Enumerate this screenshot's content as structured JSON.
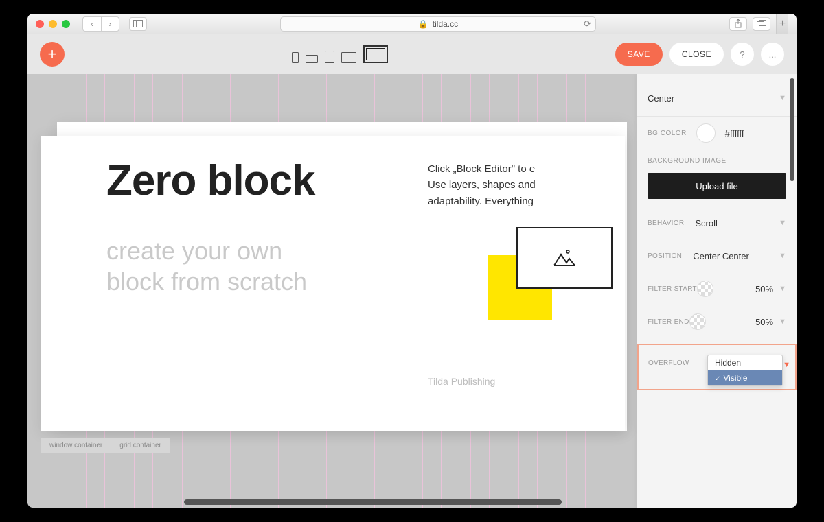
{
  "browser": {
    "url": "tilda.cc",
    "lock_icon": "🔒"
  },
  "toolbar": {
    "save_label": "SAVE",
    "close_label": "CLOSE",
    "more_label": "..."
  },
  "canvas": {
    "heading": "Zero block",
    "subtitle_line1": "create your own",
    "subtitle_line2": "block from scratch",
    "paragraph_line1": "Click „Block Editor\" to e",
    "paragraph_line2": "Use layers, shapes and",
    "paragraph_line3": "adaptability. Everything",
    "caption": "Tilda Publishing",
    "footer1": "window container",
    "footer2": "grid container"
  },
  "panel": {
    "align_value": "Center",
    "bg_color_label": "BG COLOR",
    "bg_color_value": "#ffffff",
    "bg_image_label": "BACKGROUND IMAGE",
    "upload_label": "Upload file",
    "behavior_label": "BEHAVIOR",
    "behavior_value": "Scroll",
    "position_label": "POSITION",
    "position_value": "Center Center",
    "filter_start_label": "FILTER START",
    "filter_start_value": "50%",
    "filter_end_label": "FILTER END",
    "filter_end_value": "50%",
    "overflow_label": "OVERFLOW",
    "overflow_options": {
      "hidden": "Hidden",
      "visible": "Visible"
    }
  }
}
